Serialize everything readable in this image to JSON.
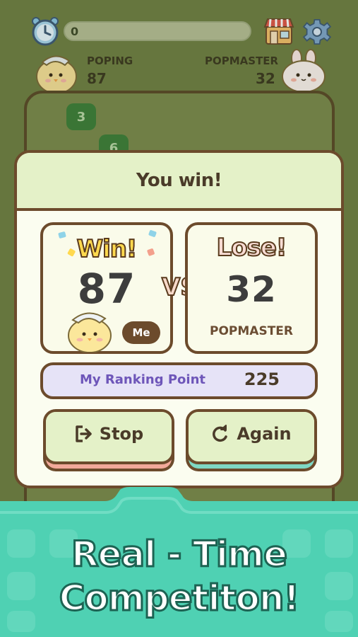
{
  "hud": {
    "timer_value": "0",
    "timer_icon": "alarm-clock-icon",
    "shop_icon": "shop-icon",
    "settings_icon": "gear-icon"
  },
  "players": {
    "left": {
      "name": "POPING",
      "score": "87"
    },
    "right": {
      "name": "POPMASTER",
      "score": "32"
    }
  },
  "board_tiles": [
    "3",
    "6"
  ],
  "popup": {
    "title": "You win!",
    "my_card": {
      "result": "Win!",
      "score": "87",
      "badge": "Me"
    },
    "vs": "VS",
    "opponent_card": {
      "result": "Lose!",
      "score": "32",
      "name": "POPMASTER"
    },
    "ranking": {
      "label": "My Ranking Point",
      "value": "225"
    },
    "buttons": {
      "stop": "Stop",
      "again": "Again"
    }
  },
  "banner": {
    "line1": "Real - Time",
    "line2": "Competiton!"
  },
  "colors": {
    "accent_green": "#e4f1c8",
    "border_brown": "#6c4b2c",
    "win_yellow": "#ffd94e",
    "banner_teal": "#4fd1b3",
    "rank_purple": "#6e56b9"
  }
}
